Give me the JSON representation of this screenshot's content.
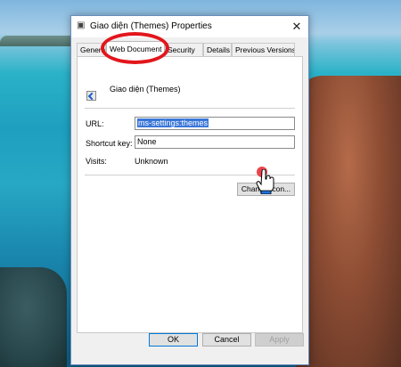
{
  "window": {
    "title": "Giao diện (Themes) Properties",
    "close_symbol": "✕"
  },
  "tabs": [
    {
      "label": "General",
      "active": false
    },
    {
      "label": "Web Document",
      "active": true
    },
    {
      "label": "Security",
      "active": false
    },
    {
      "label": "Details",
      "active": false
    },
    {
      "label": "Previous Versions",
      "active": false
    }
  ],
  "content": {
    "item_name": "Giao diện (Themes)",
    "url_label": "URL:",
    "url_value": "ms-settings:themes",
    "shortcut_label": "Shortcut key:",
    "shortcut_value": "None",
    "visits_label": "Visits:",
    "visits_value": "Unknown",
    "change_icon_label": "Change Icon..."
  },
  "buttons": {
    "ok": "OK",
    "cancel": "Cancel",
    "apply": "Apply"
  },
  "annotation": {
    "highlight_color": "#e2161c",
    "cursor_icon": "hand-pointer-icon"
  }
}
